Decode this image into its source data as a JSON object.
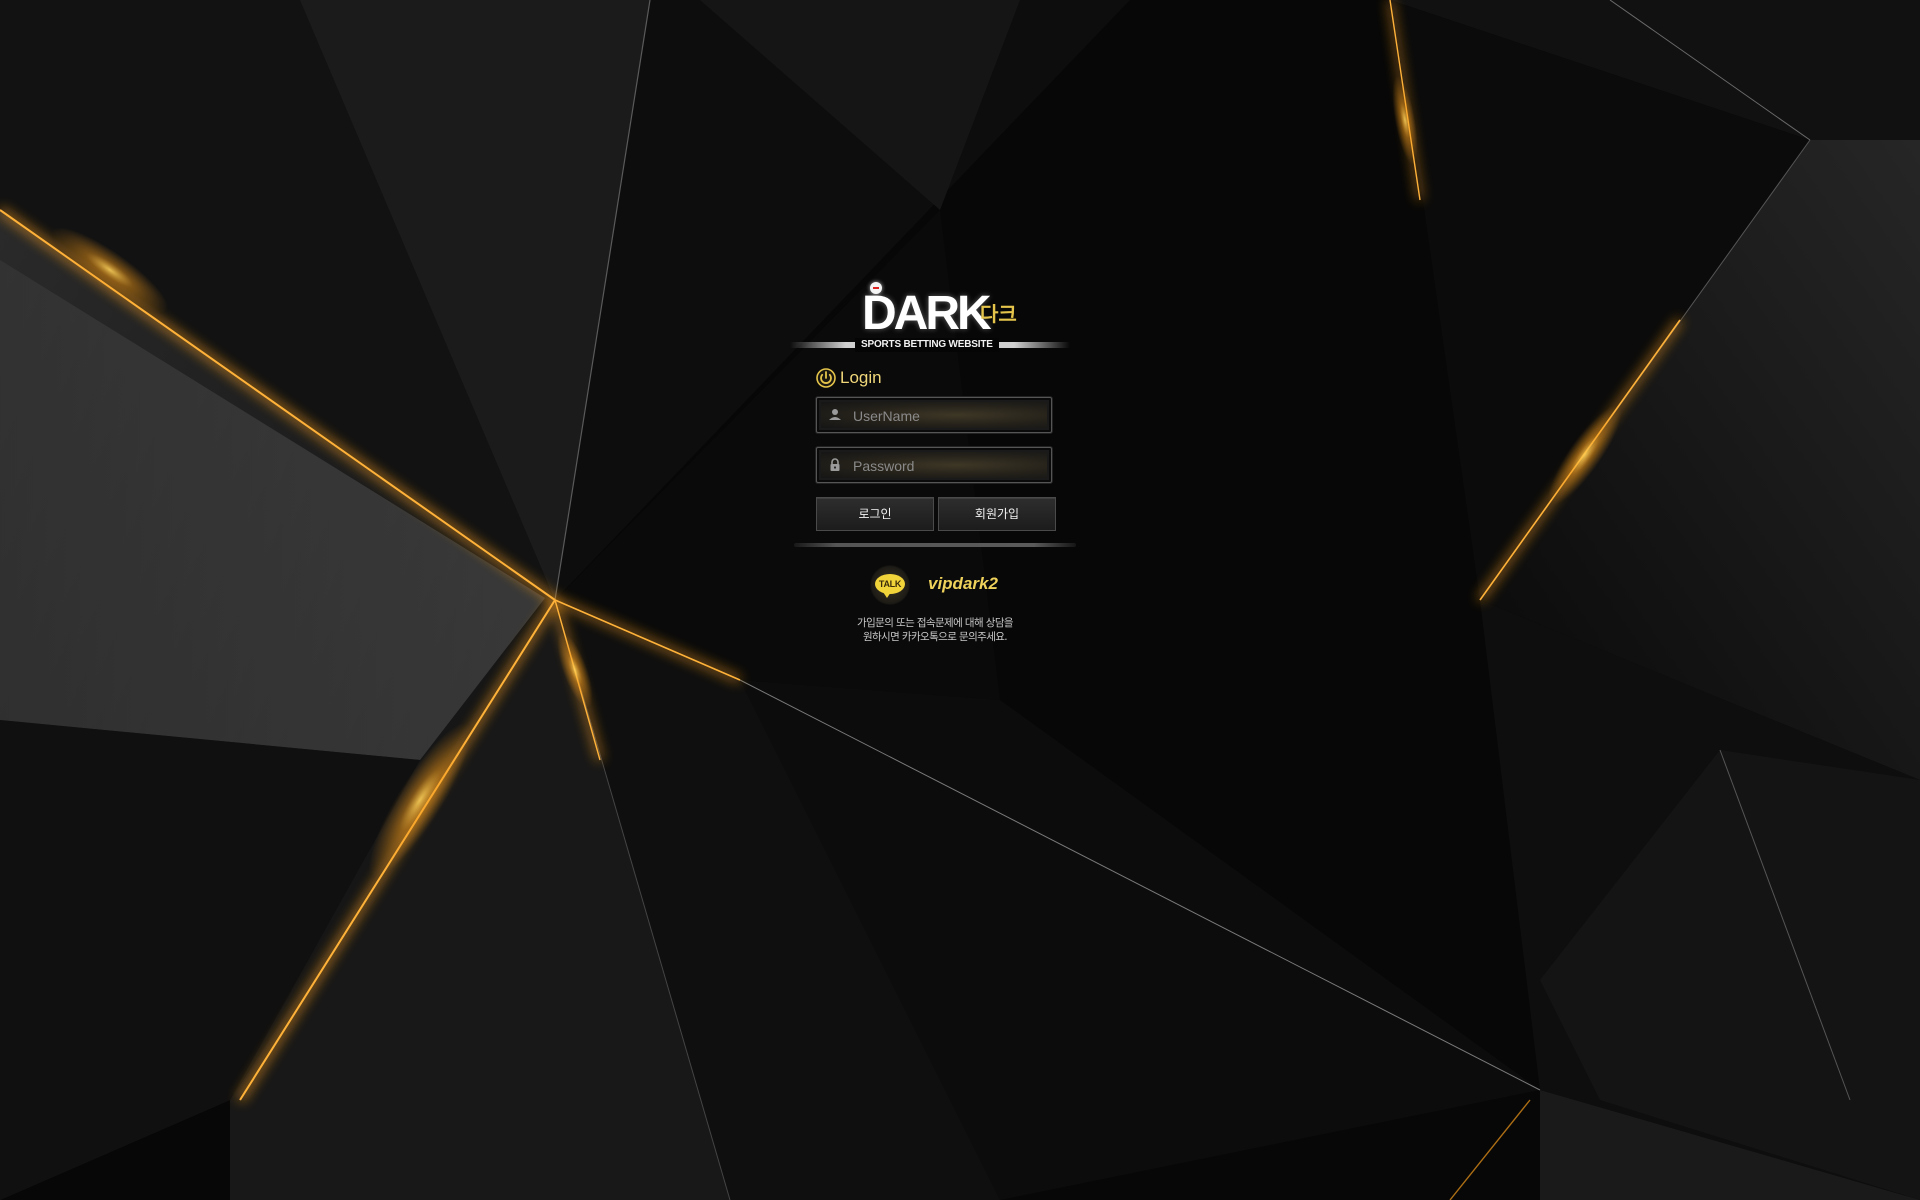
{
  "brand": {
    "name": "DARK",
    "name_korean": "다크",
    "tagline": "SPORTS BETTING WEBSITE"
  },
  "login": {
    "title": "Login",
    "username_placeholder": "UserName",
    "password_placeholder": "Password",
    "login_button": "로그인",
    "signup_button": "회원가입"
  },
  "support": {
    "talk_badge": "TALK",
    "kakao_id": "vipdark2",
    "help_line_1": "가입문의 또는 접속문제에 대해 상담을",
    "help_line_2": "원하시면 카카오톡으로 문의주세요."
  },
  "icons": {
    "login": "power-icon",
    "username": "user-icon",
    "password": "lock-icon",
    "talk": "kakaotalk-icon"
  },
  "colors": {
    "accent_gold": "#e4c44a",
    "highlight_orange": "#f39a1a",
    "background": "#070707"
  }
}
